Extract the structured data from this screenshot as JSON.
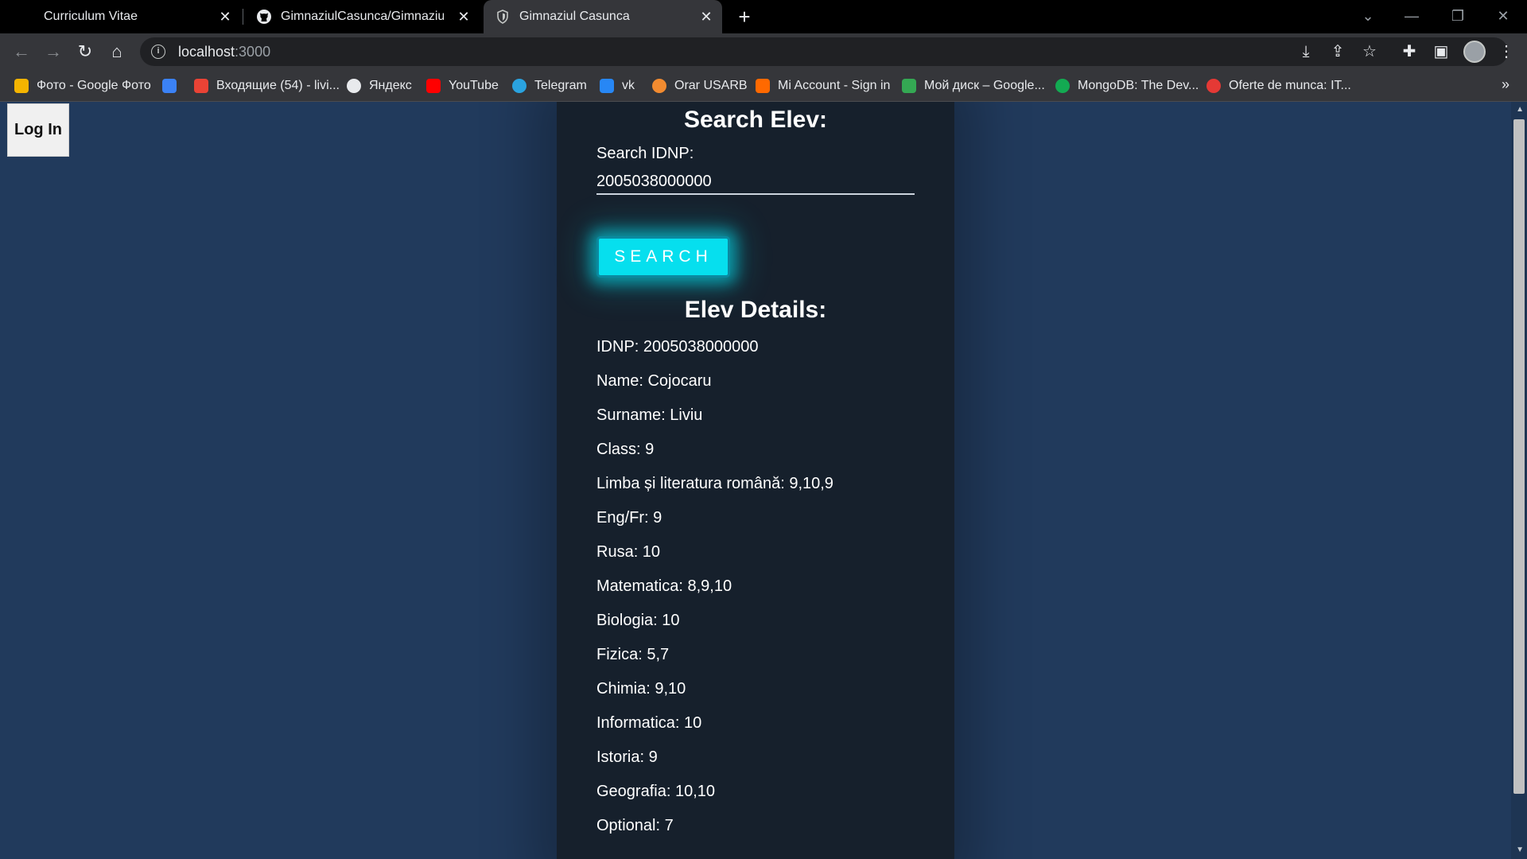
{
  "browser": {
    "tabs": [
      {
        "title": "Curriculum Vitae",
        "icon": "document-icon"
      },
      {
        "title": "GimnaziulCasunca/GimnaziulCasunca",
        "icon": "github-icon"
      },
      {
        "title": "Gimnaziul Casunca",
        "icon": "shield-icon",
        "active": true
      }
    ],
    "url_host": "localhost",
    "url_port": ":3000",
    "bookmarks": [
      {
        "label": "Фото - Google Фото",
        "color": "#f4b400"
      },
      {
        "label": "",
        "color": "#3b82f6"
      },
      {
        "label": "Входящие (54) - livi...",
        "color": "#ea4335"
      },
      {
        "label": "Яндекс",
        "color": "#e8eaed"
      },
      {
        "label": "YouTube",
        "color": "#ff0000"
      },
      {
        "label": "Telegram",
        "color": "#2aa3e0"
      },
      {
        "label": "vk",
        "color": "#2787f5"
      },
      {
        "label": "Orar USARB",
        "color": "#f28b30"
      },
      {
        "label": "Mi Account - Sign in",
        "color": "#ff6900"
      },
      {
        "label": "Мой диск – Google...",
        "color": "#34a853"
      },
      {
        "label": "MongoDB: The Dev...",
        "color": "#13aa52"
      },
      {
        "label": "Oferte de munca: IT...",
        "color": "#e53935"
      }
    ]
  },
  "page": {
    "login_label": "Log In",
    "search_title": "Search Elev:",
    "idnp_label": "Search IDNP:",
    "idnp_value": "2005038000000",
    "search_button": "Search",
    "details_title": "Elev Details:",
    "details": [
      "IDNP: 2005038000000",
      "Name: Cojocaru",
      "Surname: Liviu",
      "Class: 9",
      "Limba și literatura română: 9,10,9",
      "Eng/Fr: 9",
      "Rusa: 10",
      "Matematica: 8,9,10",
      "Biologia: 10",
      "Fizica: 5,7",
      "Chimia: 9,10",
      "Informatica: 10",
      "Istoria: 9",
      "Geografia: 10,10",
      "Optional: 7"
    ]
  }
}
